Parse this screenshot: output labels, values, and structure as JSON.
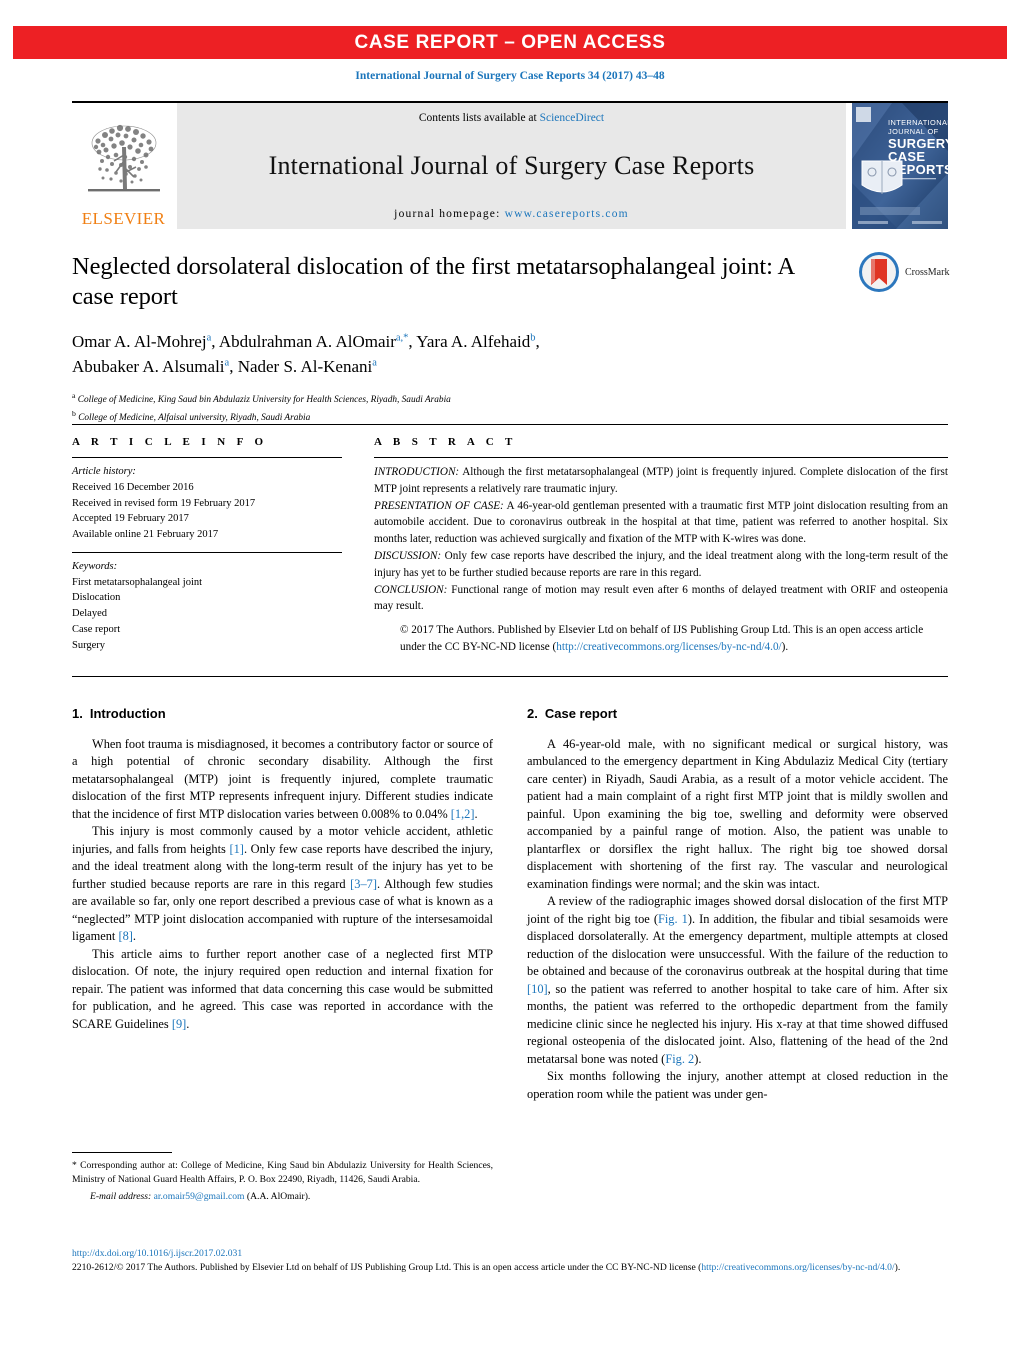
{
  "banner": {
    "text": "CASE REPORT – OPEN ACCESS"
  },
  "citation": {
    "text": "International Journal of Surgery Case Reports 34 (2017) 43–48"
  },
  "masthead": {
    "publisher_name": "ELSEVIER",
    "contents_prefix": "Contents lists available at ",
    "contents_link": "ScienceDirect",
    "journal_title": "International Journal of Surgery Case Reports",
    "homepage_prefix": "journal homepage: ",
    "homepage_url": "www.casereports.com",
    "cover": {
      "line1": "INTERNATIONAL",
      "line2": "JOURNAL OF",
      "line3": "SURGERY",
      "line4": "CASE",
      "line5": "REPORTS"
    }
  },
  "article": {
    "title": "Neglected dorsolateral dislocation of the first metatarsophalangeal joint: A case report",
    "authors": [
      {
        "name": "Omar A. Al-Mohrej",
        "marks": "a"
      },
      {
        "name": "Abdulrahman A. AlOmair",
        "marks": "a,*"
      },
      {
        "name": "Yara A. Alfehaid",
        "marks": "b"
      },
      {
        "name": "Abubaker A. Alsumali",
        "marks": "a"
      },
      {
        "name": "Nader S. Al-Kenani",
        "marks": "a"
      }
    ],
    "affiliations": [
      {
        "mark": "a",
        "text": "College of Medicine, King Saud bin Abdulaziz University for Health Sciences, Riyadh, Saudi Arabia"
      },
      {
        "mark": "b",
        "text": "College of Medicine, Alfaisal university, Riyadh, Saudi Arabia"
      }
    ],
    "crossmark_label": "CrossMark"
  },
  "article_info": {
    "section_label": "A R T I C L E   I N F O",
    "history_label": "Article history:",
    "history": [
      "Received 16 December 2016",
      "Received in revised form 19 February 2017",
      "Accepted 19 February 2017",
      "Available online 21 February 2017"
    ],
    "keywords_label": "Keywords:",
    "keywords": [
      "First metatarsophalangeal joint",
      "Dislocation",
      "Delayed",
      "Case report",
      "Surgery"
    ]
  },
  "abstract": {
    "section_label": "A B S T R A C T",
    "paragraphs": [
      {
        "lead": "INTRODUCTION:",
        "text": " Although the first metatarsophalangeal (MTP) joint is frequently injured. Complete dislocation of the first MTP joint represents a relatively rare traumatic injury."
      },
      {
        "lead": "PRESENTATION OF CASE:",
        "text": " A 46-year-old gentleman presented with a traumatic first MTP joint dislocation resulting from an automobile accident. Due to coronavirus outbreak in the hospital at that time, patient was referred to another hospital. Six months later, reduction was achieved surgically and fixation of the MTP with K-wires was done."
      },
      {
        "lead": "DISCUSSION:",
        "text": " Only few case reports have described the injury, and the ideal treatment along with the long-term result of the injury has yet to be further studied because reports are rare in this regard."
      },
      {
        "lead": "CONCLUSION:",
        "text": " Functional range of motion may result even after 6 months of delayed treatment with ORIF and osteopenia may result."
      }
    ],
    "copyright_text": "© 2017 The Authors. Published by Elsevier Ltd on behalf of IJS Publishing Group Ltd. This is an open access article under the CC BY-NC-ND license (",
    "copyright_link": "http://creativecommons.org/licenses/by-nc-nd/4.0/",
    "copyright_tail": ")."
  },
  "body": {
    "left_column": {
      "heading_number": "1.",
      "heading_title": "Introduction",
      "paragraphs": [
        "When foot trauma is misdiagnosed, it becomes a contributory factor or source of a high potential of chronic secondary disability. Although the first metatarsophalangeal (MTP) joint is frequently injured, complete traumatic dislocation of the first MTP represents infrequent injury. Different studies indicate that the incidence of first MTP dislocation varies between 0.008% to 0.04% [1,2].",
        "This injury is most commonly caused by a motor vehicle accident, athletic injuries, and falls from heights [1]. Only few case reports have described the injury, and the ideal treatment along with the long-term result of the injury has yet to be further studied because reports are rare in this regard [3–7]. Although few studies are available so far, only one report described a previous case of what is known as a “neglected” MTP joint dislocation accompanied with rupture of the intersesamoidal ligament [8].",
        "This article aims to further report another case of a neglected first MTP dislocation. Of note, the injury required open reduction and internal fixation for repair. The patient was informed that data concerning this case would be submitted for publication, and he agreed. This case was reported in accordance with the SCARE Guidelines [9]."
      ]
    },
    "right_column": {
      "heading_number": "2.",
      "heading_title": "Case report",
      "paragraphs": [
        "A 46-year-old male, with no significant medical or surgical history, was ambulanced to the emergency department in King Abdulaziz Medical City (tertiary care center) in Riyadh, Saudi Arabia, as a result of a motor vehicle accident. The patient had a main complaint of a right first MTP joint that is mildly swollen and painful. Upon examining the big toe, swelling and deformity were observed accompanied by a painful range of motion. Also, the patient was unable to plantarflex or dorsiflex the right hallux. The right big toe showed dorsal displacement with shortening of the first ray. The vascular and neurological examination findings were normal; and the skin was intact.",
        "A review of the radiographic images showed dorsal dislocation of the first MTP joint of the right big toe (Fig. 1). In addition, the fibular and tibial sesamoids were displaced dorsolaterally. At the emergency department, multiple attempts at closed reduction of the dislocation were unsuccessful. With the failure of the reduction to be obtained and because of the coronavirus outbreak at the hospital during that time [10], so the patient was referred to another hospital to take care of him. After six months, the patient was referred to the orthopedic department from the family medicine clinic since he neglected his injury. His x-ray at that time showed diffused regional osteopenia of the dislocated joint. Also, flattening of the head of the 2nd metatarsal bone was noted (Fig. 2).",
        "Six months following the injury, another attempt at closed reduction in the operation room while the patient was under gen-"
      ]
    }
  },
  "footnote": {
    "corresponding": "* Corresponding author at: College of Medicine, King Saud bin Abdulaziz University for Health Sciences, Ministry of National Guard Health Affairs, P. O. Box 22490, Riyadh, 11426, Saudi Arabia.",
    "email_label": "E-mail address:",
    "email": "ar.omair59@gmail.com",
    "email_owner": "(A.A. AlOmair)."
  },
  "bottom_meta": {
    "doi": "http://dx.doi.org/10.1016/j.ijscr.2017.02.031",
    "license_text": "2210-2612/© 2017 The Authors. Published by Elsevier Ltd on behalf of IJS Publishing Group Ltd. This is an open access article under the CC BY-NC-ND license (",
    "license_link": "http://creativecommons.org/licenses/by-nc-nd/4.0/",
    "license_tail": ")."
  },
  "colors": {
    "banner_red": "#ED2024",
    "link_blue": "#1b75bb",
    "elsevier_orange": "#F07F13",
    "masthead_gray": "#E8E8E8"
  }
}
